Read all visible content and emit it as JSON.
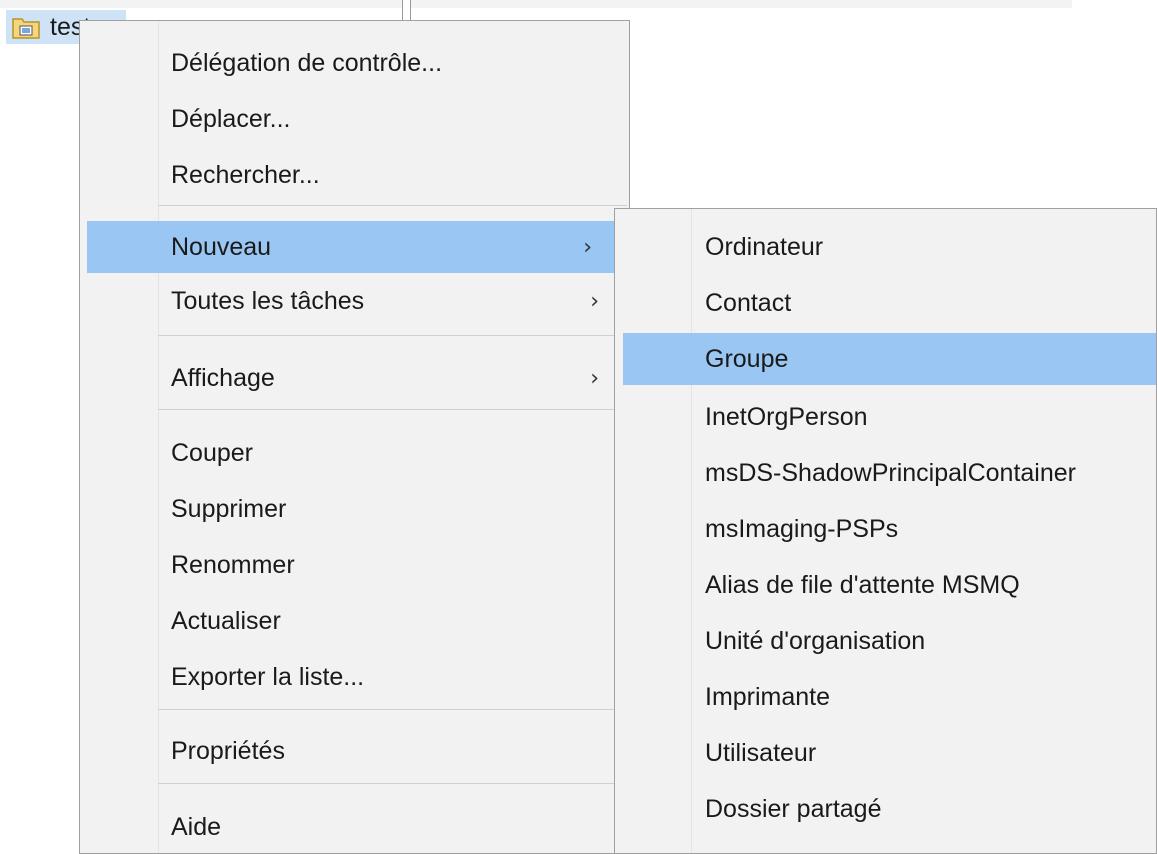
{
  "tree": {
    "node_label": "test"
  },
  "context_menu": {
    "items": [
      {
        "label": "Délégation de contrôle..."
      },
      {
        "label": "Déplacer..."
      },
      {
        "label": "Rechercher..."
      },
      {
        "label": "Nouveau",
        "arrow": "›",
        "highlighted": true
      },
      {
        "label": "Toutes les tâches",
        "arrow": "›"
      },
      {
        "label": "Affichage",
        "arrow": "›"
      },
      {
        "label": "Couper"
      },
      {
        "label": "Supprimer"
      },
      {
        "label": "Renommer"
      },
      {
        "label": "Actualiser"
      },
      {
        "label": "Exporter la liste..."
      },
      {
        "label": "Propriétés"
      },
      {
        "label": "Aide"
      }
    ]
  },
  "submenu_nouveau": {
    "items": [
      {
        "label": "Ordinateur"
      },
      {
        "label": "Contact"
      },
      {
        "label": "Groupe",
        "highlighted": true
      },
      {
        "label": "InetOrgPerson"
      },
      {
        "label": "msDS-ShadowPrincipalContainer"
      },
      {
        "label": "msImaging-PSPs"
      },
      {
        "label": "Alias de file d'attente MSMQ"
      },
      {
        "label": "Unité d'organisation"
      },
      {
        "label": "Imprimante"
      },
      {
        "label": "Utilisateur"
      },
      {
        "label": "Dossier partagé"
      }
    ]
  },
  "colors": {
    "menu_background": "#f2f2f2",
    "highlight": "#99c6f2",
    "tree_selection": "#cfe3f7"
  }
}
